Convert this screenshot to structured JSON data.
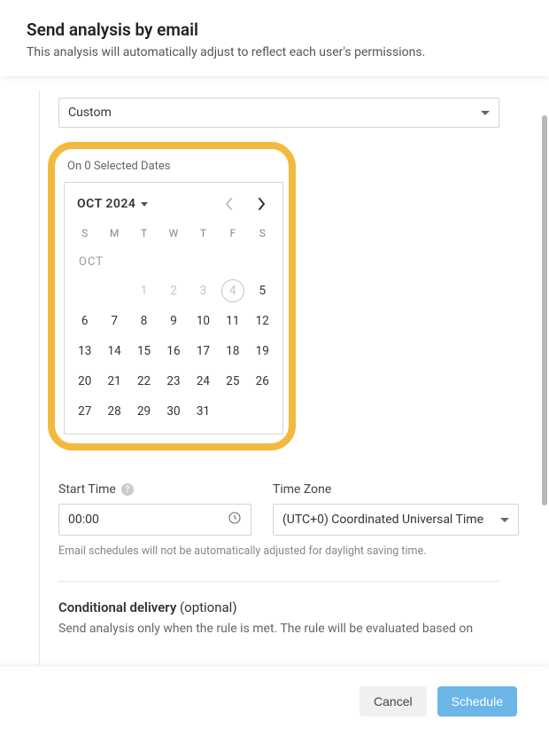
{
  "header": {
    "title": "Send analysis by email",
    "subtitle": "This analysis will automatically adjust to reflect each user's permissions."
  },
  "frequency_select": {
    "value": "Custom"
  },
  "highlight": {
    "label": "On 0 Selected Dates"
  },
  "calendar": {
    "month_label": "OCT 2024",
    "mid_label": "OCT",
    "dow": [
      "S",
      "M",
      "T",
      "W",
      "T",
      "F",
      "S"
    ],
    "weeks": [
      [
        {
          "d": "",
          "cls": "empty"
        },
        {
          "d": "",
          "cls": "empty"
        },
        {
          "d": "1",
          "cls": "past"
        },
        {
          "d": "2",
          "cls": "past"
        },
        {
          "d": "3",
          "cls": "past"
        },
        {
          "d": "4",
          "cls": "today"
        },
        {
          "d": "5",
          "cls": ""
        }
      ],
      [
        {
          "d": "6",
          "cls": ""
        },
        {
          "d": "7",
          "cls": ""
        },
        {
          "d": "8",
          "cls": ""
        },
        {
          "d": "9",
          "cls": ""
        },
        {
          "d": "10",
          "cls": ""
        },
        {
          "d": "11",
          "cls": ""
        },
        {
          "d": "12",
          "cls": ""
        }
      ],
      [
        {
          "d": "13",
          "cls": ""
        },
        {
          "d": "14",
          "cls": ""
        },
        {
          "d": "15",
          "cls": ""
        },
        {
          "d": "16",
          "cls": ""
        },
        {
          "d": "17",
          "cls": ""
        },
        {
          "d": "18",
          "cls": ""
        },
        {
          "d": "19",
          "cls": ""
        }
      ],
      [
        {
          "d": "20",
          "cls": ""
        },
        {
          "d": "21",
          "cls": ""
        },
        {
          "d": "22",
          "cls": ""
        },
        {
          "d": "23",
          "cls": ""
        },
        {
          "d": "24",
          "cls": ""
        },
        {
          "d": "25",
          "cls": ""
        },
        {
          "d": "26",
          "cls": ""
        }
      ],
      [
        {
          "d": "27",
          "cls": ""
        },
        {
          "d": "28",
          "cls": ""
        },
        {
          "d": "29",
          "cls": ""
        },
        {
          "d": "30",
          "cls": ""
        },
        {
          "d": "31",
          "cls": ""
        },
        {
          "d": "",
          "cls": "empty"
        },
        {
          "d": "",
          "cls": "empty"
        }
      ]
    ]
  },
  "start_time": {
    "label": "Start Time",
    "value": "00:00"
  },
  "timezone": {
    "label": "Time Zone",
    "value": "(UTC+0) Coordinated Universal Time"
  },
  "dst_hint": "Email schedules will not be automatically adjusted for daylight saving time.",
  "conditional": {
    "title_strong": "Conditional delivery",
    "title_rest": " (optional)",
    "desc": "Send analysis only when the rule is met. The rule will be evaluated based on"
  },
  "footer": {
    "cancel": "Cancel",
    "schedule": "Schedule"
  }
}
